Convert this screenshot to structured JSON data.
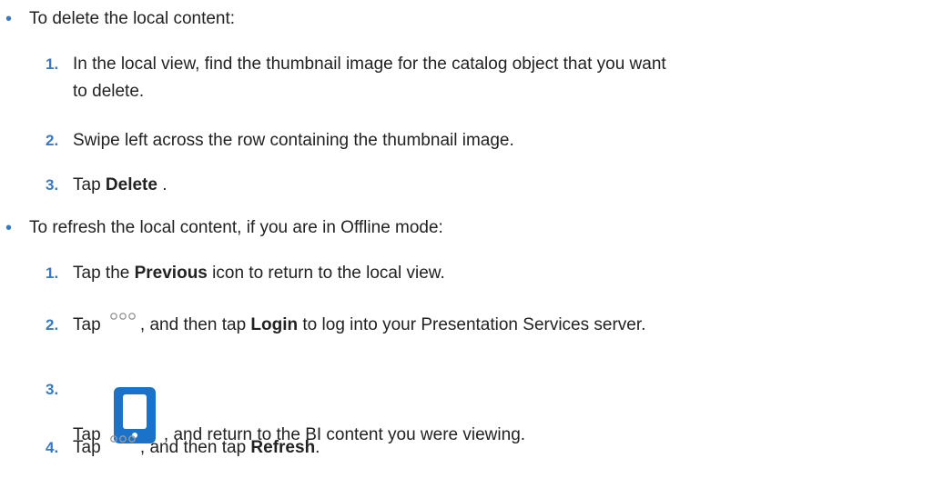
{
  "bullets": [
    {
      "text": "To delete the local content:",
      "steps": [
        {
          "num": "1.",
          "line1": "In the local view, find the thumbnail image for the catalog object that you want",
          "line2": "to delete."
        },
        {
          "num": "2.",
          "text": "Swipe left across the row containing the thumbnail image."
        },
        {
          "num": "3.",
          "pre": "Tap ",
          "bold": "Delete",
          "post": " ."
        }
      ]
    },
    {
      "text": "To refresh the local content, if you are in Offline mode:",
      "steps": [
        {
          "num": "1.",
          "pre": "Tap the ",
          "bold": "Previous",
          "post": " icon to return to the local view."
        },
        {
          "num": "2.",
          "pre": "Tap ",
          "icon": "more-options-icon",
          "mid": ", and then tap ",
          "bold": "Login",
          "post": " to log into your Presentation Services server."
        },
        {
          "num": "3.",
          "pre": "Tap ",
          "icon": "mobile-device-icon",
          "post": ", and return to the BI content you were viewing."
        },
        {
          "num": "4.",
          "pre": "Tap ",
          "icon": "more-options-icon",
          "mid": ", and then tap ",
          "bold": "Refresh",
          "post": "."
        }
      ]
    }
  ],
  "colors": {
    "accent": "#3a78c2",
    "icon_blue": "#1a73c9",
    "icon_gray": "#9a9a9a"
  }
}
